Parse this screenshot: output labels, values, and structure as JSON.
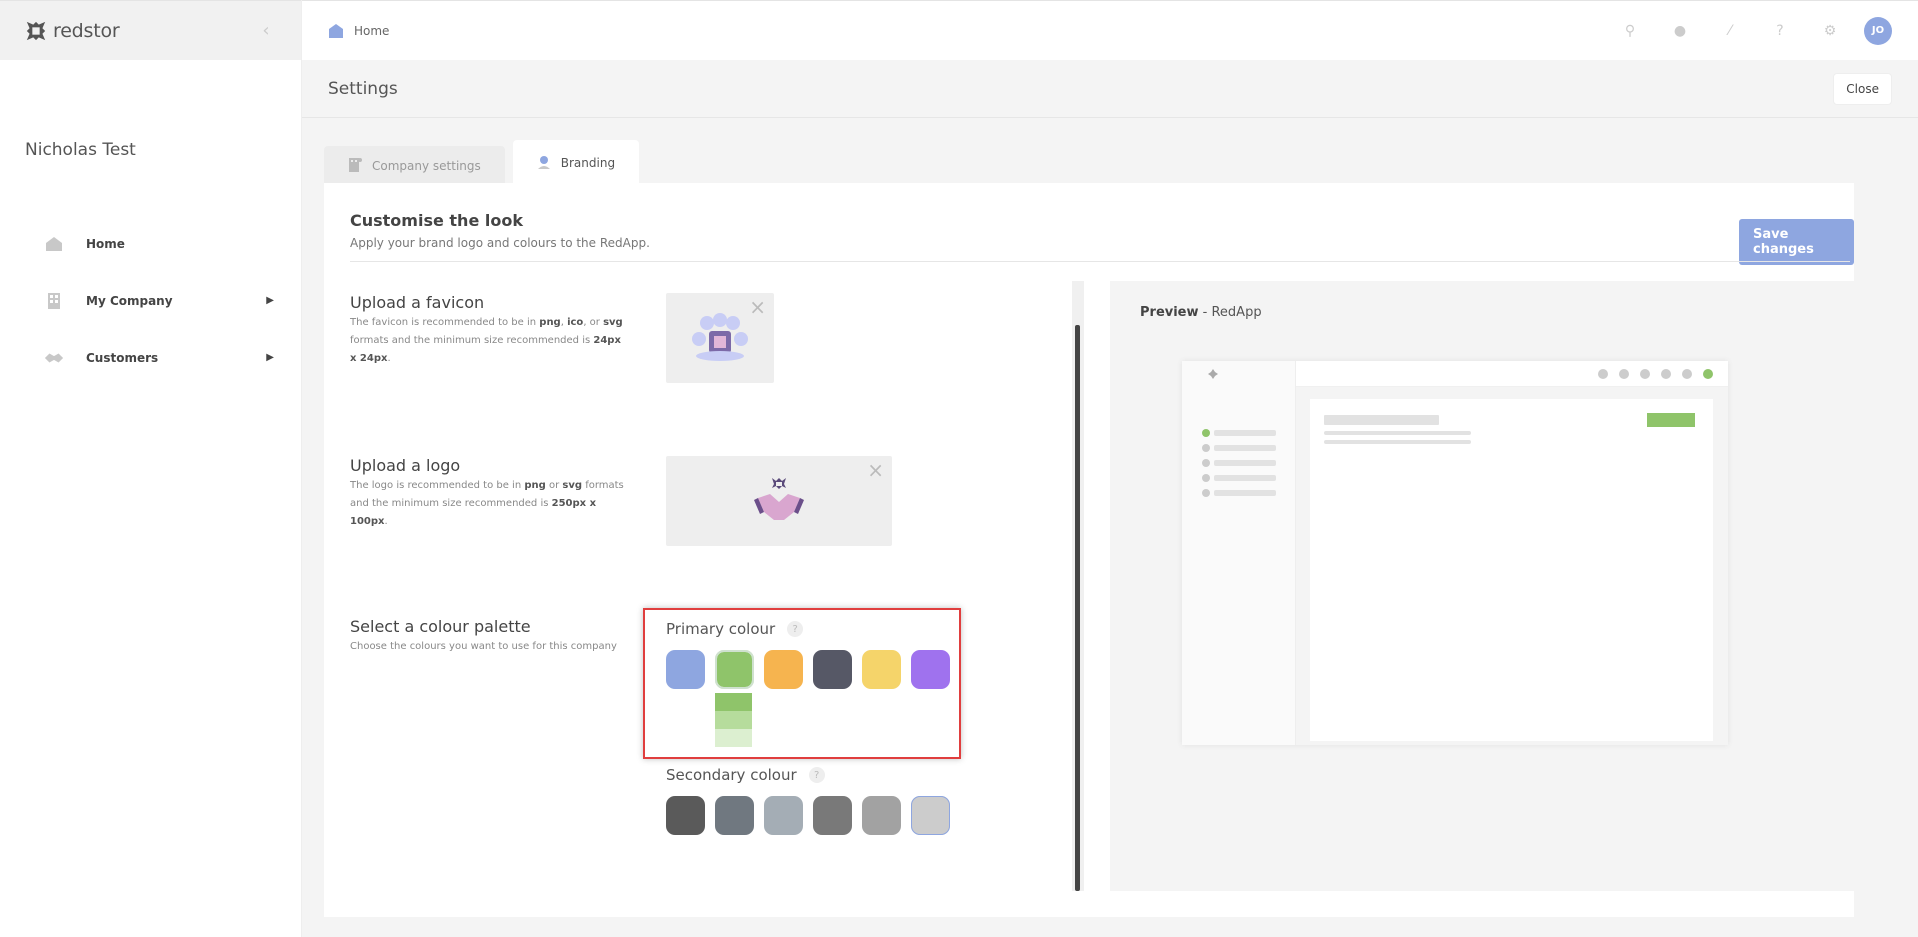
{
  "brand": {
    "name": "redstor"
  },
  "sidebar": {
    "company_name": "Nicholas Test",
    "items": [
      {
        "label": "Home",
        "icon": "home-icon",
        "has_submenu": false
      },
      {
        "label": "My Company",
        "icon": "building-icon",
        "has_submenu": true
      },
      {
        "label": "Customers",
        "icon": "handshake-icon",
        "has_submenu": true
      }
    ]
  },
  "topbar": {
    "breadcrumb": "Home",
    "icons": [
      "search-file-icon",
      "bell-icon",
      "code-icon",
      "help-icon",
      "gear-icon"
    ],
    "avatar_initials": "JO"
  },
  "page": {
    "title": "Settings",
    "close_label": "Close"
  },
  "tabs": [
    {
      "label": "Company settings",
      "icon": "building-icon",
      "active": false
    },
    {
      "label": "Branding",
      "icon": "user-icon",
      "active": true
    }
  ],
  "branding": {
    "heading": "Customise the look",
    "subheading": "Apply your brand logo and colours to the RedApp.",
    "save_label": "Save changes",
    "favicon": {
      "title": "Upload a favicon",
      "desc_1": "The favicon is recommended to be in ",
      "fmt_1": "png",
      "sep_1": ", ",
      "fmt_2": "ico",
      "sep_2": ", or ",
      "fmt_3": "svg",
      "desc_2": " formats and the minimum size recommended is ",
      "size": "24px x 24px",
      "desc_3": "."
    },
    "logo": {
      "title": "Upload a logo",
      "desc_1": "The logo is recommended to be in ",
      "fmt_1": "png",
      "sep_1": " or ",
      "fmt_2": "svg",
      "desc_2": " formats and the minimum size recommended is ",
      "size": "250px x 100px",
      "desc_3": "."
    },
    "palette": {
      "title": "Select a colour palette",
      "desc": "Choose the colours you want to use for this company",
      "primary_label": "Primary colour",
      "secondary_label": "Secondary colour",
      "help_glyph": "?",
      "primary_colors": [
        "#8ea6e0",
        "#8fc46a",
        "#f6b44f",
        "#565866",
        "#f5d46a",
        "#9f72ee"
      ],
      "primary_selected_index": 1,
      "primary_shades": [
        "#8fc46a",
        "#b6dc9c",
        "#dcefd0"
      ],
      "secondary_colors": [
        "#5a5a5a",
        "#707880",
        "#a4adb5",
        "#797979",
        "#a2a2a2",
        "#cccccc"
      ],
      "secondary_selected_index": 5
    }
  },
  "preview": {
    "label_bold": "Preview",
    "label_rest": " - RedApp",
    "accent_color": "#8fc46a"
  }
}
